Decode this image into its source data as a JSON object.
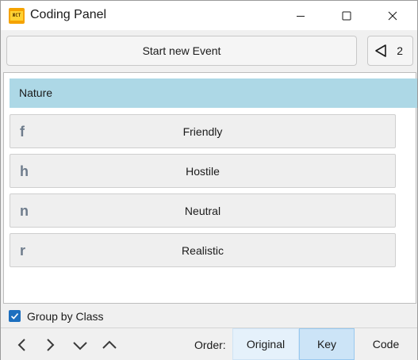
{
  "window": {
    "title": "Coding Panel",
    "app_icon": "app-logo-icon",
    "controls": [
      "minimize-icon",
      "maximize-icon",
      "close-icon"
    ]
  },
  "toolbar": {
    "start_label": "Start new Event",
    "back_icon": "triangle-left-icon",
    "back_count": "2"
  },
  "list": {
    "group_header": "Nature",
    "group_color": "#add8e6",
    "codes": [
      {
        "key": "f",
        "label": "Friendly"
      },
      {
        "key": "h",
        "label": "Hostile"
      },
      {
        "key": "n",
        "label": "Neutral"
      },
      {
        "key": "r",
        "label": "Realistic"
      }
    ]
  },
  "options": {
    "group_by_class_label": "Group by Class",
    "group_by_class_checked": true
  },
  "bottom": {
    "nav_icons": [
      "chevron-left-icon",
      "chevron-right-icon",
      "chevron-down-icon",
      "chevron-up-icon"
    ],
    "order_label": "Order:",
    "order_options": [
      "Original",
      "Key",
      "Code"
    ],
    "order_selected": "Key",
    "accent_color": "#cce4f7"
  }
}
